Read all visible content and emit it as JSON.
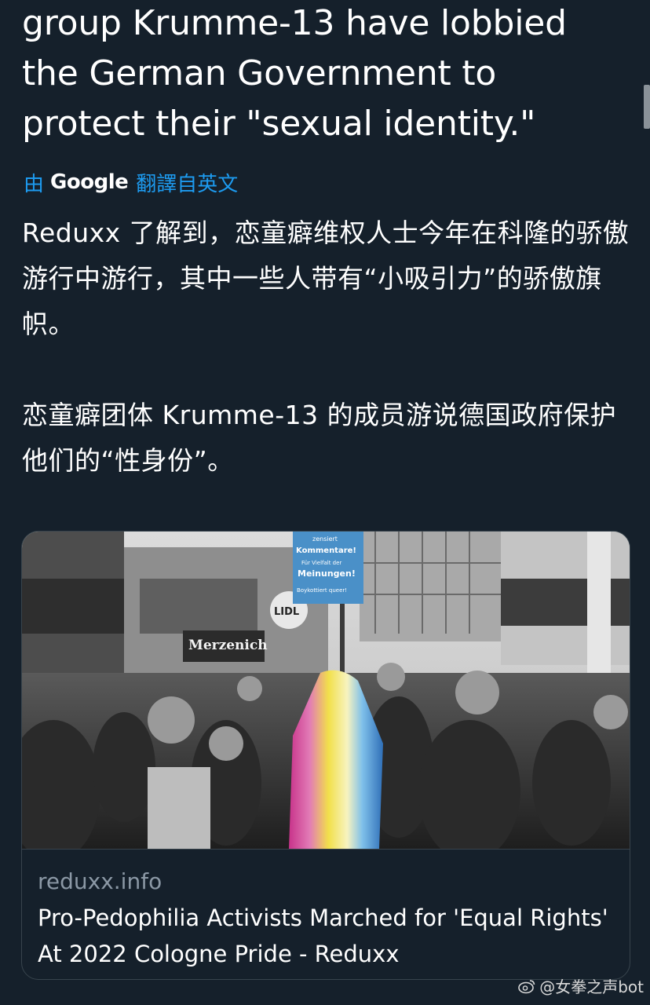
{
  "tweet": {
    "text_en": "group Krumme-13 have lobbied\nthe German Government to\nprotect their \"sexual identity.\"",
    "translate": {
      "by": "由",
      "google": "Google",
      "from": "翻譯自英文"
    },
    "text_zh_1": "Reduxx 了解到，恋童癖维权人士今年在科隆的骄傲游行中游行，其中一些人带有“小吸引力”的骄傲旗帜。",
    "text_zh_2": "恋童癖团体 Krumme-13 的成员游说德国政府保护他们的“性身份”。"
  },
  "card": {
    "domain": "reduxx.info",
    "title": "Pro-Pedophilia Activists Marched for 'Equal Rights' At 2022 Cologne Pride - Reduxx",
    "image_signs": {
      "placard_1": "zensiert",
      "placard_2": "Kommentare!",
      "placard_3": "Für Vielfalt der",
      "placard_4": "Meinungen!",
      "placard_5": "Boykottiert queer!",
      "store": "Merzenich",
      "lidl": "LIDL"
    }
  },
  "watermark": {
    "text": "@女拳之声bot"
  },
  "colors": {
    "background": "#15202b",
    "accent": "#1d9bf0",
    "muted": "#8b98a5",
    "border": "#38444d"
  }
}
